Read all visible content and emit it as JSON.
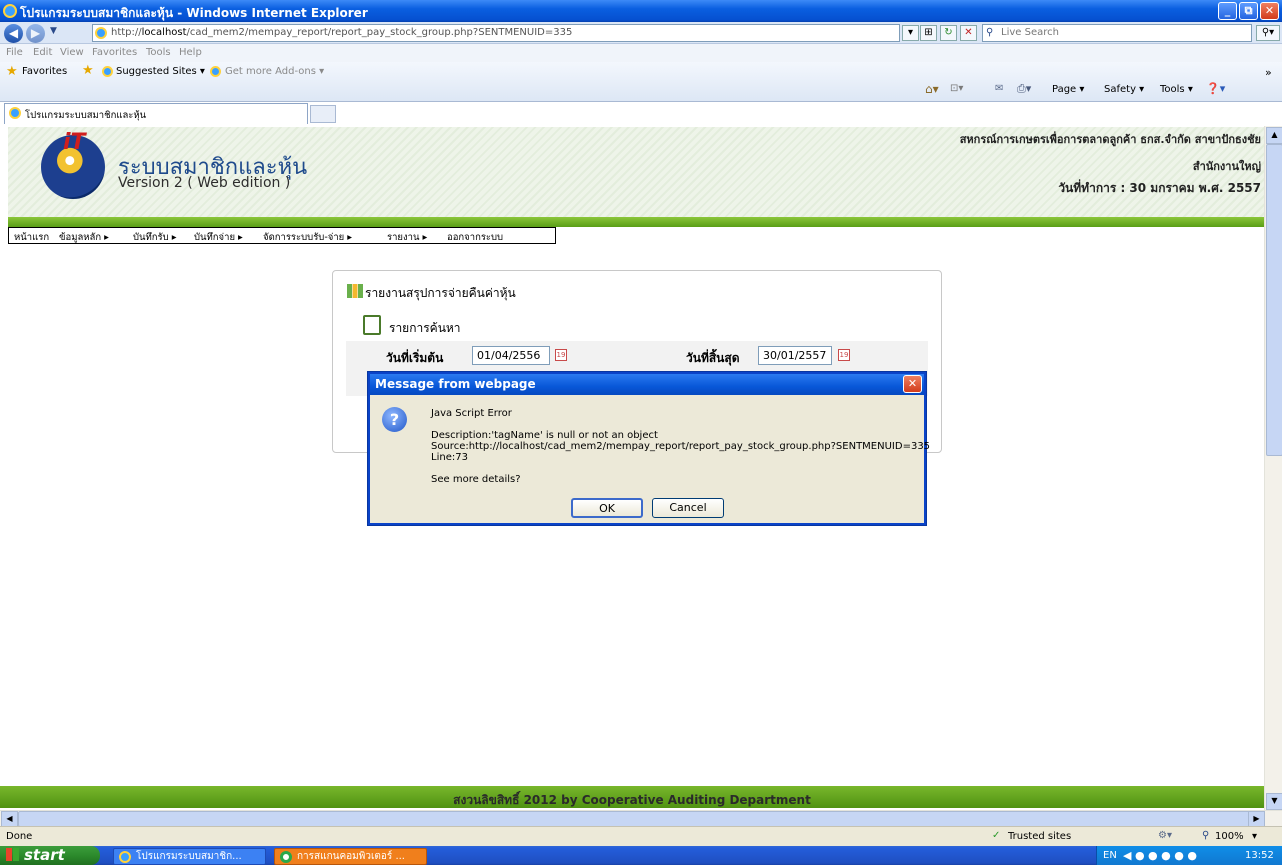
{
  "window": {
    "title": "โปรแกรมระบบสมาชิกและหุ้น - Windows Internet Explorer",
    "minimize": "_",
    "maximize": "⧉",
    "close": "✕"
  },
  "address": {
    "url_prefix": "http://",
    "url_host": "localhost",
    "url_path": "/cad_mem2/mempay_report/report_pay_stock_group.php?SENTMENUID=335",
    "search_placeholder": "Live Search"
  },
  "menu": [
    "File",
    "Edit",
    "View",
    "Favorites",
    "Tools",
    "Help"
  ],
  "favorites": {
    "favorites_label": "Favorites",
    "suggested_sites": "Suggested Sites ▾",
    "addons": "Get more Add-ons ▾"
  },
  "tab": {
    "title": "โปรแกรมระบบสมาชิกและหุ้น"
  },
  "command_bar": {
    "page": "Page ▾",
    "safety": "Safety ▾",
    "tools": "Tools ▾"
  },
  "header": {
    "app_name": "ระบบสมาชิกและหุ้น",
    "version": "Version 2 ( Web edition )",
    "org": "สหกรณ์การเกษตรเพื่อการตลาดลูกค้า ธกส.จำกัด สาขาปักธงชัย",
    "branch": "สำนักงานใหญ่",
    "date": "วันที่ทำการ : 30 มกราคม พ.ศ. 2557"
  },
  "nav": [
    {
      "label": "หน้าแรก"
    },
    {
      "label": "ข้อมูลหลัก ▸"
    },
    {
      "label": "บันทึกรับ ▸"
    },
    {
      "label": "บันทึกจ่าย ▸"
    },
    {
      "label": "จัดการระบบรับ-จ่าย ▸"
    },
    {
      "label": "รายงาน ▸"
    },
    {
      "label": "ออกจากระบบ"
    }
  ],
  "report": {
    "title": "รายงานสรุปการจ่ายคืนค่าหุ้น",
    "section": "รายการค้นหา",
    "start_label": "วันที่เริ่มต้น",
    "start_value": "01/04/2556",
    "end_label": "วันที่สิ้นสุด",
    "end_value": "30/01/2557"
  },
  "dialog": {
    "title": "Message from webpage",
    "line1": "Java Script Error",
    "line2": "Description:'tagName' is null or not an object",
    "line3": "Source:http://localhost/cad_mem2/mempay_report/report_pay_stock_group.php?SENTMENUID=335",
    "line4": "Line:73",
    "line5": "See more details?",
    "ok": "OK",
    "cancel": "Cancel"
  },
  "footer": {
    "copyright": "สงวนลิขสิทธิ์ 2012 by Cooperative Auditing Department"
  },
  "status": {
    "left": "Done",
    "zone": "Trusted sites",
    "zoom": "100%"
  },
  "taskbar": {
    "start": "start",
    "item1": "โปรแกรมระบบสมาชิก...",
    "item2": "การสแกนคอมพิวเตอร์ ...",
    "lang": "EN",
    "clock": "13:52"
  }
}
